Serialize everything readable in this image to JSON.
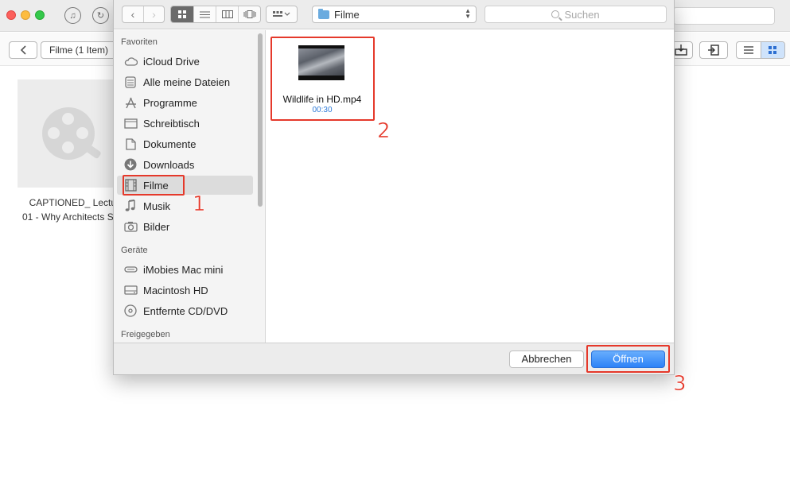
{
  "app": {
    "breadcrumb": "Filme (1 Item)",
    "media_items": [
      {
        "caption_line1": "CAPTIONED_ Lectur",
        "caption_line2": "01 - Why Architects S"
      }
    ]
  },
  "dialog": {
    "path": "Filme",
    "search_placeholder": "Suchen",
    "sidebar": {
      "sections": [
        {
          "title": "Favoriten",
          "items": [
            {
              "label": "iCloud Drive",
              "icon": "cloud-icon"
            },
            {
              "label": "Alle meine Dateien",
              "icon": "all-files-icon"
            },
            {
              "label": "Programme",
              "icon": "apps-icon"
            },
            {
              "label": "Schreibtisch",
              "icon": "desktop-icon"
            },
            {
              "label": "Dokumente",
              "icon": "document-icon"
            },
            {
              "label": "Downloads",
              "icon": "download-icon"
            },
            {
              "label": "Filme",
              "icon": "film-icon",
              "selected": true
            },
            {
              "label": "Musik",
              "icon": "music-icon"
            },
            {
              "label": "Bilder",
              "icon": "camera-icon"
            }
          ]
        },
        {
          "title": "Geräte",
          "items": [
            {
              "label": "iMobies Mac mini",
              "icon": "mac-mini-icon"
            },
            {
              "label": "Macintosh HD",
              "icon": "harddisk-icon"
            },
            {
              "label": "Entfernte CD/DVD",
              "icon": "disc-icon"
            }
          ]
        },
        {
          "title": "Freigegeben",
          "items": []
        }
      ]
    },
    "files": [
      {
        "name": "Wildlife in HD.mp4",
        "duration": "00:30"
      }
    ],
    "buttons": {
      "cancel": "Abbrechen",
      "open": "Öffnen"
    }
  },
  "annotations": {
    "step1": "1",
    "step2": "2",
    "step3": "3",
    "color": "#e5392b"
  },
  "colors": {
    "accent": "#2d82f7",
    "selection": "#dcdcdc",
    "annotation": "#e5392b"
  }
}
